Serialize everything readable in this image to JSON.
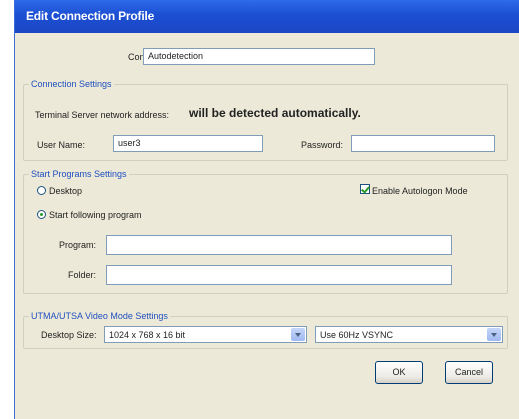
{
  "window": {
    "title": "Edit Connection Profile"
  },
  "connection": {
    "label": "Connection:",
    "value": "Autodetection"
  },
  "connection_settings": {
    "legend": "Connection Settings",
    "address_label": "Terminal Server network address:",
    "address_value": "will be detected automatically.",
    "username_label": "User Name:",
    "username_value": "user3",
    "password_label": "Password:",
    "password_value": ""
  },
  "start_program": {
    "legend": "Start Programs  Settings",
    "desktop_label": "Desktop",
    "following_label": "Start following program",
    "autologon_label": "Enable Autologon Mode",
    "program_label": "Program:",
    "program_value": "",
    "folder_label": "Folder:",
    "folder_value": ""
  },
  "video": {
    "legend": "UTMA/UTSA  Video Mode Settings",
    "size_label": "Desktop Size:",
    "size_value": "1024 x 768 x 16 bit",
    "refresh_value": "Use 60Hz VSYNC"
  },
  "buttons": {
    "ok": "OK",
    "cancel": "Cancel"
  }
}
